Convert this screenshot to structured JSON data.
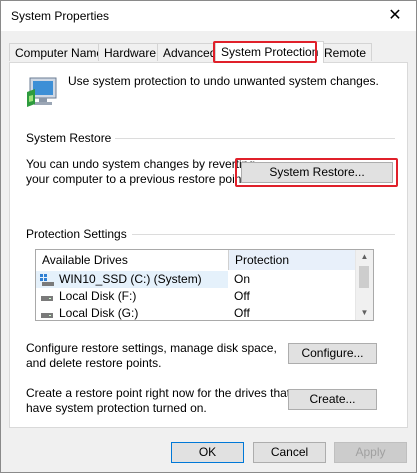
{
  "window": {
    "title": "System Properties",
    "close_glyph": "✕"
  },
  "tabs": [
    {
      "label": "Computer Name"
    },
    {
      "label": "Hardware"
    },
    {
      "label": "Advanced"
    },
    {
      "label": "System Protection"
    },
    {
      "label": "Remote"
    }
  ],
  "intro_text": "Use system protection to undo unwanted system changes.",
  "system_restore": {
    "title": "System Restore",
    "description_line1": "You can undo system changes by reverting",
    "description_line2": "your computer to a previous restore point.",
    "button": "System Restore..."
  },
  "protection_settings": {
    "title": "Protection Settings",
    "columns": [
      "Available Drives",
      "Protection"
    ],
    "drives": [
      {
        "name": "WIN10_SSD (C:) (System)",
        "protection": "On"
      },
      {
        "name": "Local Disk (F:)",
        "protection": "Off"
      },
      {
        "name": "Local Disk (G:)",
        "protection": "Off"
      }
    ],
    "configure_text_line1": "Configure restore settings, manage disk space,",
    "configure_text_line2": "and delete restore points.",
    "configure_button": "Configure...",
    "create_text_line1": "Create a restore point right now for the drives that",
    "create_text_line2": "have system protection turned on.",
    "create_button": "Create..."
  },
  "footer": {
    "ok": "OK",
    "cancel": "Cancel",
    "apply": "Apply"
  },
  "colors": {
    "highlight": "#e0202a",
    "default_button_border": "#0078d7"
  }
}
